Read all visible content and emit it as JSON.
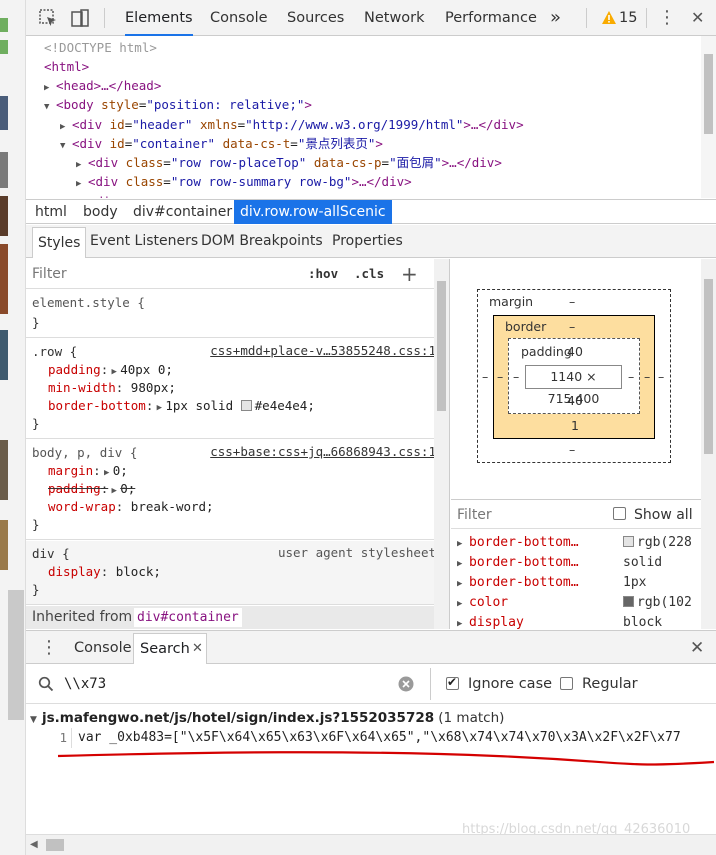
{
  "toolbar": {
    "tabs": [
      "Elements",
      "Console",
      "Sources",
      "Network",
      "Performance"
    ],
    "more": "»",
    "warning_count": "15",
    "kebab": "⋮",
    "close": "✕"
  },
  "dom": {
    "doctype": "<!DOCTYPE html>",
    "html": "<html>",
    "head": "<head>…</head>",
    "body_tag": "body",
    "body_attr": "style",
    "body_val": "\"position: relative;\"",
    "div1_attr1": "id",
    "div1_val1": "\"header\"",
    "div1_attr2": "xmlns",
    "div1_val2": "\"http://www.w3.org/1999/html\"",
    "div1_end": ">…</div>",
    "div2_attr1": "id",
    "div2_val1": "\"container\"",
    "div2_attr2": "data-cs-t",
    "div2_val2": "\"景点列表页\"",
    "div3_attr1": "class",
    "div3_val1": "\"row row-placeTop\"",
    "div3_attr2": "data-cs-p",
    "div3_val2": "\"面包屑\"",
    "div3_end": ">…</div>",
    "div4_attr1": "class",
    "div4_val1": "\"row row-summary row-bg\"",
    "div4_end": ">…</div>"
  },
  "breadcrumbs": [
    "html",
    "body",
    "div#container",
    "div.row.row-allScenic"
  ],
  "subtabs": [
    "Styles",
    "Event Listeners",
    "DOM Breakpoints",
    "Properties"
  ],
  "styles": {
    "filter_placeholder": "Filter",
    "hov": ":hov",
    "cls": ".cls",
    "plus": "+",
    "element_style": "element.style {",
    "close_brace": "}",
    "row_selector": ".row {",
    "row_source": "css+mdd+place-v…53855248.css:1",
    "row_props": [
      {
        "name": "padding",
        "value": "40px 0;",
        "tri": true
      },
      {
        "name": "min-width",
        "value": "980px;",
        "tri": false
      },
      {
        "name": "border-bottom",
        "value": "1px solid",
        "tri": true,
        "color": "#e4e4e4",
        "color_label": "#e4e4e4;"
      }
    ],
    "base_selector": "body, p, div {",
    "base_source": "css+base:css+jq…66868943.css:1",
    "base_props": [
      {
        "name": "margin",
        "value": "0;",
        "tri": true,
        "strike": false
      },
      {
        "name": "padding",
        "value": "0;",
        "tri": true,
        "strike": true
      },
      {
        "name": "word-wrap",
        "value": "break-word;",
        "tri": false,
        "strike": false
      }
    ],
    "div_selector": "div {",
    "div_source": "user agent stylesheet",
    "div_prop": {
      "name": "display",
      "value": "block;"
    },
    "inherited_label": "Inherited from",
    "inherited_from": "div#container"
  },
  "boxmodel": {
    "margin_label": "margin",
    "margin_top": "–",
    "margin_bottom": "–",
    "margin_left": "–",
    "margin_right": "–",
    "border_label": "border",
    "border_top": "–",
    "border_bottom": "1",
    "border_left": "–",
    "border_right": "–",
    "padding_label": "padding",
    "padding_top": "40",
    "padding_bottom": "40",
    "padding_left": "–",
    "padding_right": "–",
    "content": "1140 × 715.400"
  },
  "computed": {
    "filter_placeholder": "Filter",
    "show_all": "Show all",
    "rows": [
      {
        "name": "border-bottom…",
        "value": "rgb(228",
        "swatch": "#e4e4e4"
      },
      {
        "name": "border-bottom…",
        "value": "solid",
        "swatch": ""
      },
      {
        "name": "border-bottom…",
        "value": "1px",
        "swatch": ""
      },
      {
        "name": "color",
        "value": "rgb(102",
        "swatch": "#666666"
      },
      {
        "name": "display",
        "value": "block",
        "swatch": ""
      }
    ]
  },
  "drawer": {
    "tabs": [
      "Console",
      "Search"
    ],
    "close": "✕",
    "query": "\\\\x73",
    "ignore_case": "Ignore case",
    "regex": "Regular expression",
    "result_file": "js.mafengwo.net/js/hotel/sign/index.js?1552035728",
    "result_count": "(1 match)",
    "line_number": "1",
    "line_text": "var _0xb483=[\"\\x5F\\x64\\x65\\x63\\x6F\\x64\\x65\",\"\\x68\\x74\\x74\\x70\\x3A\\x2F\\x2F\\x77"
  },
  "watermark": "https://blog.csdn.net/qq_42636010",
  "colors": {
    "accent": "#1a73e8",
    "warning": "#f9ab00",
    "underline_red": "#d40000",
    "border_box": "#fdde9f"
  }
}
